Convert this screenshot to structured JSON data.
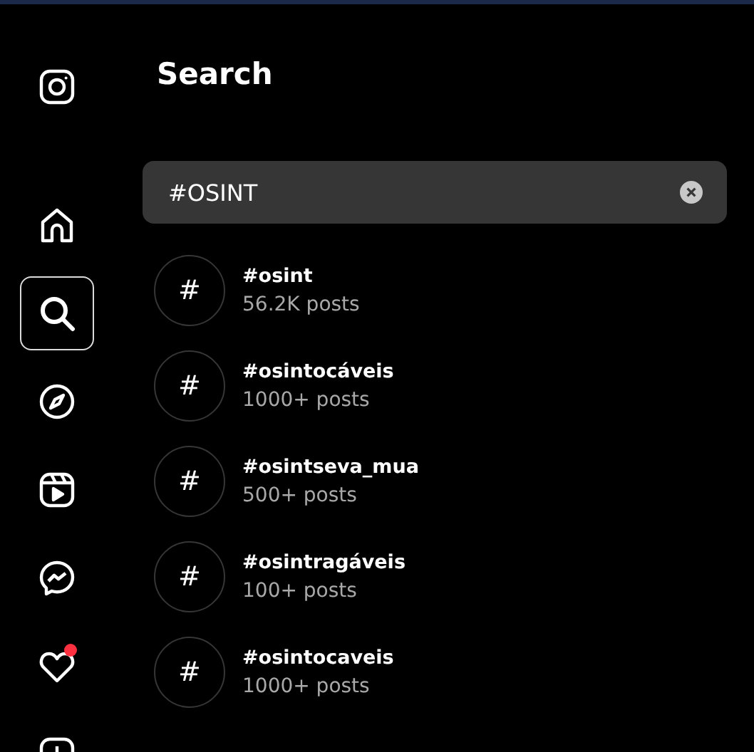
{
  "sidebar": {
    "items": [
      {
        "kind": "home",
        "selected": false,
        "notification": false
      },
      {
        "kind": "search",
        "selected": true,
        "notification": false
      },
      {
        "kind": "explore",
        "selected": false,
        "notification": false
      },
      {
        "kind": "reels",
        "selected": false,
        "notification": false
      },
      {
        "kind": "messages",
        "selected": false,
        "notification": false
      },
      {
        "kind": "notifications",
        "selected": false,
        "notification": true
      },
      {
        "kind": "create",
        "selected": false,
        "notification": false
      }
    ]
  },
  "search_panel": {
    "title": "Search",
    "search": {
      "value": "#OSINT"
    },
    "results": [
      {
        "icon": "#",
        "name": "#osint",
        "posts": "56.2K posts"
      },
      {
        "icon": "#",
        "name": "#osintocáveis",
        "posts": "1000+ posts"
      },
      {
        "icon": "#",
        "name": "#osintseva_mua",
        "posts": "500+ posts"
      },
      {
        "icon": "#",
        "name": "#osintragáveis",
        "posts": "100+ posts"
      },
      {
        "icon": "#",
        "name": "#osintocaveis",
        "posts": "1000+ posts"
      }
    ]
  }
}
